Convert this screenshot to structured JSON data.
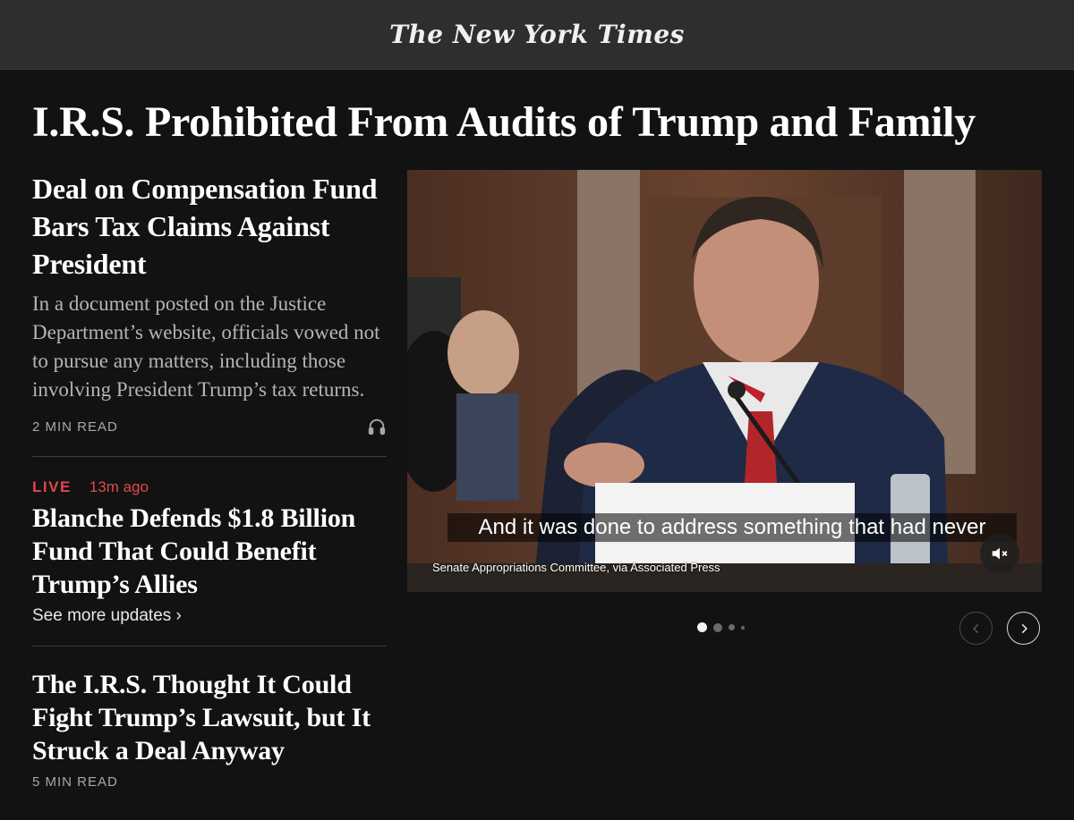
{
  "masthead": {
    "logo_text": "The New York Times"
  },
  "main_headline": "I.R.S. Prohibited From Audits of Trump and Family",
  "lead_story": {
    "headline": "Deal on Compensation Fund Bars Tax Claims Against President",
    "summary": "In a document posted on the Justice Department’s website, officials vowed not to pursue any matters, including those involving President Trump’s tax returns.",
    "read_time": "2 MIN READ",
    "audio_icon": "headphones-icon"
  },
  "live_story": {
    "live_label": "LIVE",
    "time_ago": "13m ago",
    "headline": "Blanche Defends $1.8 Billion Fund That Could Benefit Trump’s Allies",
    "see_more": "See more updates ›"
  },
  "third_story": {
    "headline": "The I.R.S. Thought It Could Fight Trump’s Lawsuit, but It Struck a Deal Anyway",
    "read_time": "5 MIN READ"
  },
  "video": {
    "caption": "And it was done to address something that had never",
    "credit": "Senate Appropriations Committee, via Associated Press",
    "mute_icon": "speaker-muted-icon"
  },
  "carousel": {
    "dot_count": 4,
    "active_index": 0,
    "prev_icon": "chevron-left-icon",
    "next_icon": "chevron-right-icon"
  },
  "colors": {
    "background": "#121212",
    "masthead_bg": "#2e2e2e",
    "live_red": "#e0474c",
    "summary_gray": "#b5b5b5"
  }
}
